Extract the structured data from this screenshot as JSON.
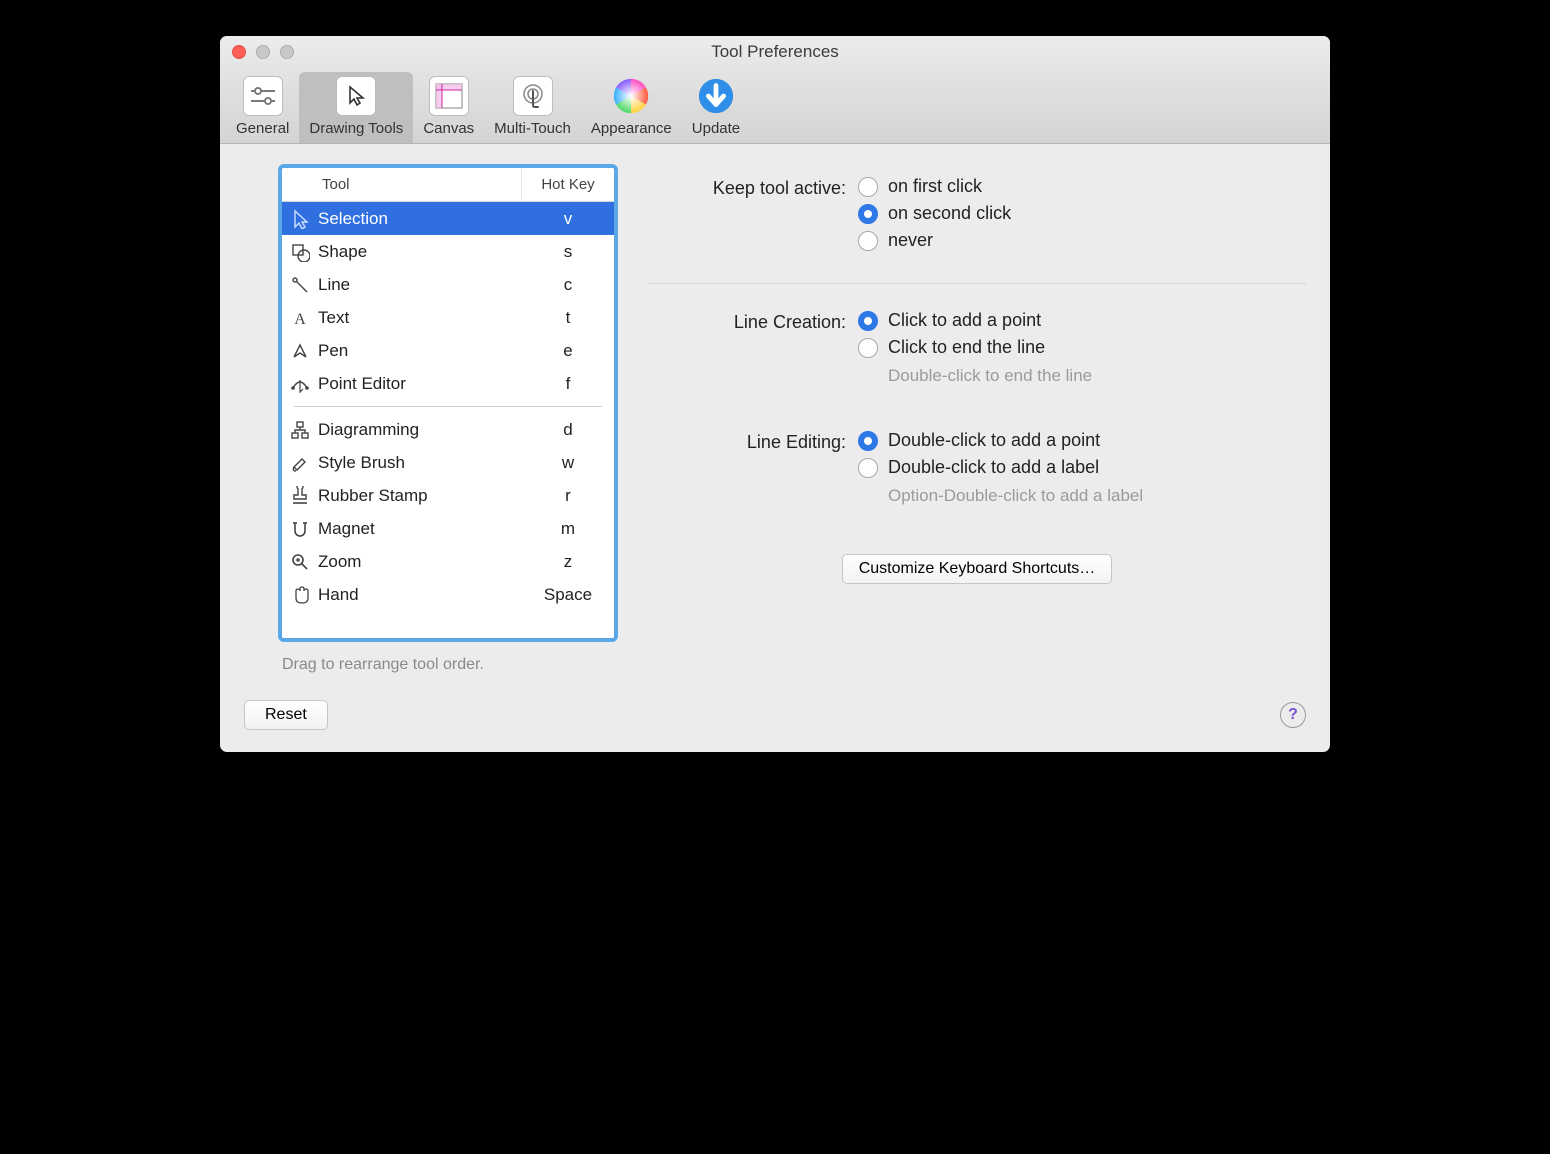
{
  "window": {
    "title": "Tool Preferences"
  },
  "toolbar": {
    "tabs": [
      {
        "id": "general",
        "label": "General"
      },
      {
        "id": "drawing-tools",
        "label": "Drawing Tools"
      },
      {
        "id": "canvas",
        "label": "Canvas"
      },
      {
        "id": "multi-touch",
        "label": "Multi-Touch"
      },
      {
        "id": "appearance",
        "label": "Appearance"
      },
      {
        "id": "update",
        "label": "Update"
      }
    ],
    "selected": "drawing-tools"
  },
  "tool_list": {
    "columns": {
      "tool": "Tool",
      "hotkey": "Hot Key"
    },
    "groups": [
      [
        {
          "icon": "cursor",
          "name": "Selection",
          "hotkey": "v",
          "selected": true
        },
        {
          "icon": "shape",
          "name": "Shape",
          "hotkey": "s"
        },
        {
          "icon": "line",
          "name": "Line",
          "hotkey": "c"
        },
        {
          "icon": "text",
          "name": "Text",
          "hotkey": "t"
        },
        {
          "icon": "pen",
          "name": "Pen",
          "hotkey": "e"
        },
        {
          "icon": "point-editor",
          "name": "Point Editor",
          "hotkey": "f"
        }
      ],
      [
        {
          "icon": "diagramming",
          "name": "Diagramming",
          "hotkey": "d"
        },
        {
          "icon": "style-brush",
          "name": "Style Brush",
          "hotkey": "w"
        },
        {
          "icon": "rubber-stamp",
          "name": "Rubber Stamp",
          "hotkey": "r"
        },
        {
          "icon": "magnet",
          "name": "Magnet",
          "hotkey": "m"
        },
        {
          "icon": "zoom",
          "name": "Zoom",
          "hotkey": "z"
        },
        {
          "icon": "hand",
          "name": "Hand",
          "hotkey": "Space"
        }
      ]
    ],
    "hint": "Drag to rearrange tool order."
  },
  "settings": {
    "keep_active": {
      "label": "Keep tool active:",
      "options": [
        "on first click",
        "on second click",
        "never"
      ],
      "selected": 1
    },
    "line_creation": {
      "label": "Line Creation:",
      "options": [
        "Click to add a point",
        "Click to end the line"
      ],
      "selected": 0,
      "hint": "Double-click to end the line"
    },
    "line_editing": {
      "label": "Line Editing:",
      "options": [
        "Double-click to add a point",
        "Double-click to add a label"
      ],
      "selected": 0,
      "hint": "Option-Double-click to add a label"
    },
    "keyboard_button": "Customize Keyboard Shortcuts…"
  },
  "footer": {
    "reset": "Reset",
    "help": "?"
  }
}
